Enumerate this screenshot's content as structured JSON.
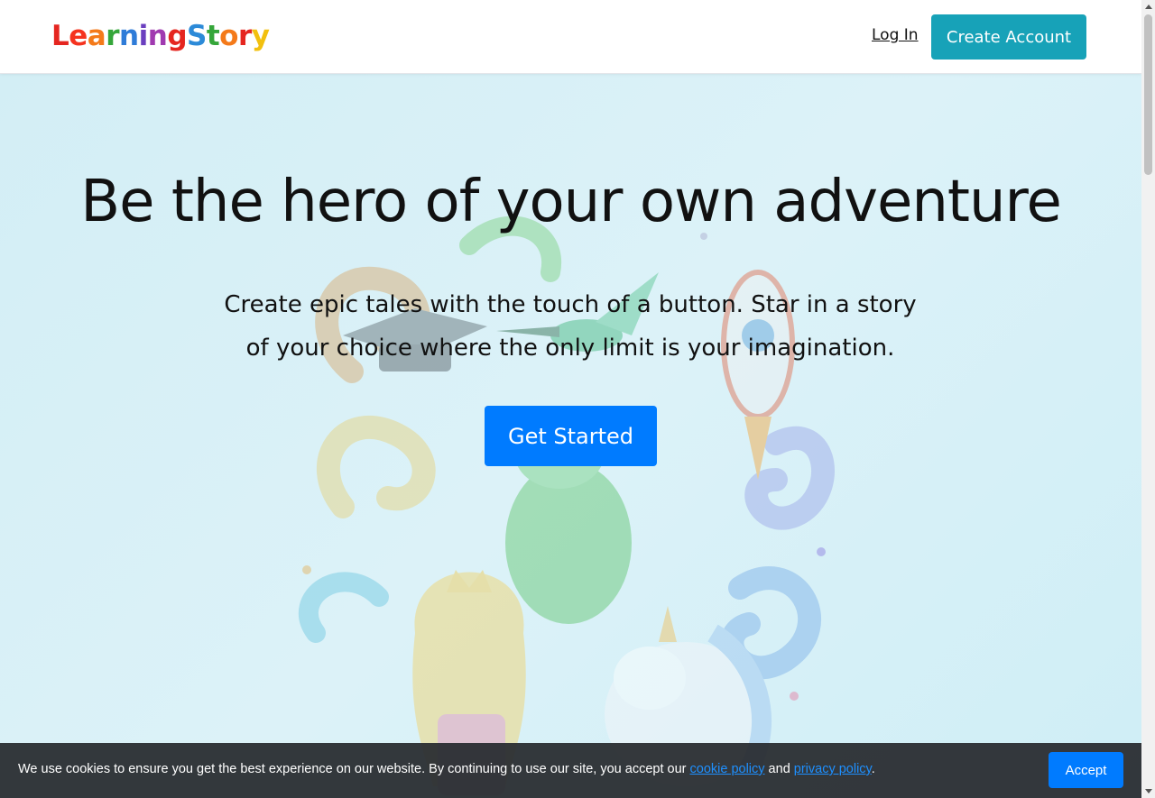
{
  "brand": {
    "letters": [
      {
        "ch": "L",
        "color": "#e52620"
      },
      {
        "ch": "e",
        "color": "#f5331f"
      },
      {
        "ch": "a",
        "color": "#f47a1a"
      },
      {
        "ch": "r",
        "color": "#35a63a"
      },
      {
        "ch": "n",
        "color": "#2f7cd8"
      },
      {
        "ch": "i",
        "color": "#6b3fbf"
      },
      {
        "ch": "n",
        "color": "#a03ab0"
      },
      {
        "ch": "g",
        "color": "#e52620"
      },
      {
        "ch": "S",
        "color": "#2c8ad8"
      },
      {
        "ch": "t",
        "color": "#35a63a"
      },
      {
        "ch": "o",
        "color": "#f47a1a"
      },
      {
        "ch": "r",
        "color": "#e52620"
      },
      {
        "ch": "y",
        "color": "#f2c00f"
      }
    ]
  },
  "nav": {
    "login_label": "Log In",
    "create_account_label": "Create Account"
  },
  "hero": {
    "title": "Be the hero of your own adventure",
    "subtitle": "Create epic tales with the touch of a button. Star in a story of your choice where the only limit is your imagination.",
    "cta_label": "Get Started"
  },
  "cookie": {
    "text_before": "We use cookies to ensure you get the best experience on our website. By continuing to use our site, you accept our ",
    "cookie_link": "cookie policy",
    "middle": " and ",
    "privacy_link": "privacy policy",
    "end": ".",
    "accept_label": "Accept"
  },
  "colors": {
    "primary": "#007bff",
    "info": "#17a2b8",
    "hero_bg": "#d6f0f7",
    "cookie_bg": "#282c30"
  }
}
